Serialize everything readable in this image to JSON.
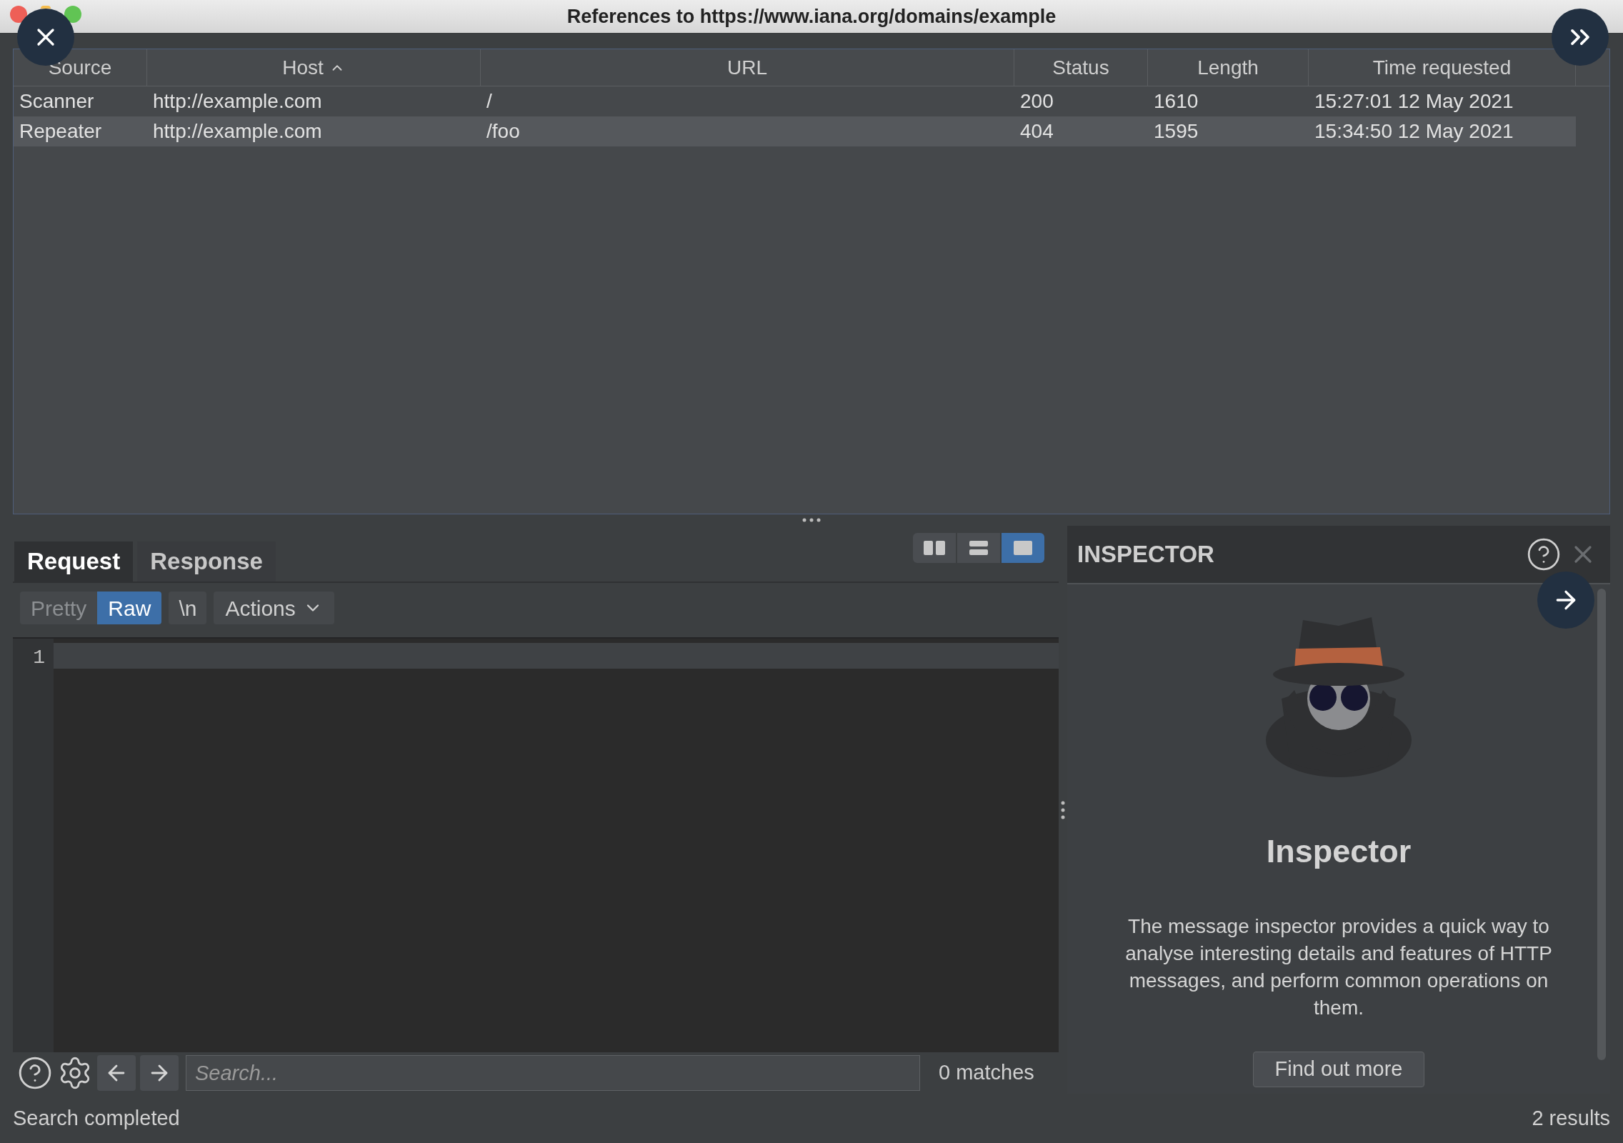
{
  "window": {
    "title": "References to https://www.iana.org/domains/example"
  },
  "table": {
    "columns": [
      {
        "label": "Source",
        "sorted_ascending": false
      },
      {
        "label": "Host",
        "sorted_ascending": true
      },
      {
        "label": "URL",
        "sorted_ascending": false
      },
      {
        "label": "Status",
        "sorted_ascending": false
      },
      {
        "label": "Length",
        "sorted_ascending": false
      },
      {
        "label": "Time requested",
        "sorted_ascending": false
      }
    ],
    "rows": [
      {
        "cells": [
          "Scanner",
          "http://example.com",
          "/",
          "200",
          "1610",
          "15:27:01 12 May 2021"
        ],
        "selected": false
      },
      {
        "cells": [
          "Repeater",
          "http://example.com",
          "/foo",
          "404",
          "1595",
          "15:34:50 12 May 2021"
        ],
        "selected": true
      }
    ]
  },
  "message_editor": {
    "tabs": [
      {
        "label": "Request",
        "selected": true
      },
      {
        "label": "Response",
        "selected": false
      }
    ],
    "layout_toggles": [
      {
        "kind": "columns",
        "selected": false
      },
      {
        "kind": "rows",
        "selected": false
      },
      {
        "kind": "single",
        "selected": true
      }
    ],
    "format_buttons": [
      {
        "label": "Pretty",
        "selected": false
      },
      {
        "label": "Raw",
        "selected": true
      },
      {
        "label": "\\n",
        "selected": false
      }
    ],
    "actions": {
      "label": "Actions"
    },
    "line_numbers": [
      "1"
    ],
    "search": {
      "placeholder": "Search...",
      "matches": "0 matches"
    }
  },
  "inspector": {
    "title": "INSPECTOR",
    "heading": "Inspector",
    "description": "The message inspector provides a quick way to analyse interesting details and features of HTTP messages, and perform common operations on them.",
    "button": "Find out more"
  },
  "status_bar": {
    "left": "Search completed",
    "right": "2 results"
  }
}
